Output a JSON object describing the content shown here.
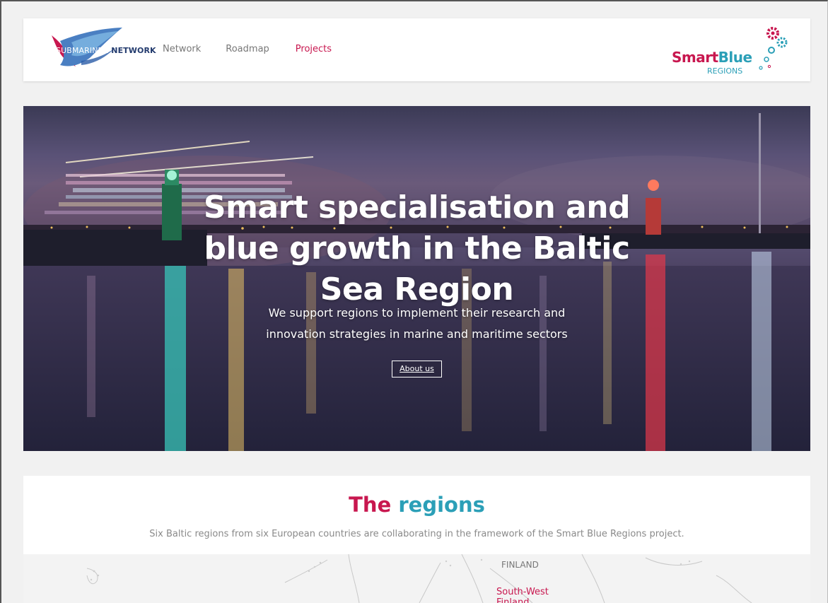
{
  "header": {
    "logo_left_text": "SUBMARINER NETWORK",
    "nav": [
      {
        "label": "Network",
        "active": false
      },
      {
        "label": "Roadmap",
        "active": false
      },
      {
        "label": "Projects",
        "active": true
      }
    ],
    "logo_right": {
      "word1": "Smart",
      "word2": "Blue",
      "word3": "REGIONS"
    }
  },
  "hero": {
    "title": "Smart specialisation and blue growth in the Baltic Sea Region",
    "subtitle_line1": "We support regions to implement their research and",
    "subtitle_line2": "innovation strategies in marine and maritime sectors",
    "button_label": "About us"
  },
  "regions": {
    "title_part1": "The",
    "title_part2": "regions",
    "subtitle": "Six Baltic regions from six European countries are collaborating in the framework of the Smart Blue Regions project.",
    "map_labels": {
      "country": "FINLAND",
      "region": "South-West Finland"
    }
  },
  "colors": {
    "accent_pink": "#c8174f",
    "accent_blue": "#2b9fb7",
    "nav_gray": "#777777"
  }
}
